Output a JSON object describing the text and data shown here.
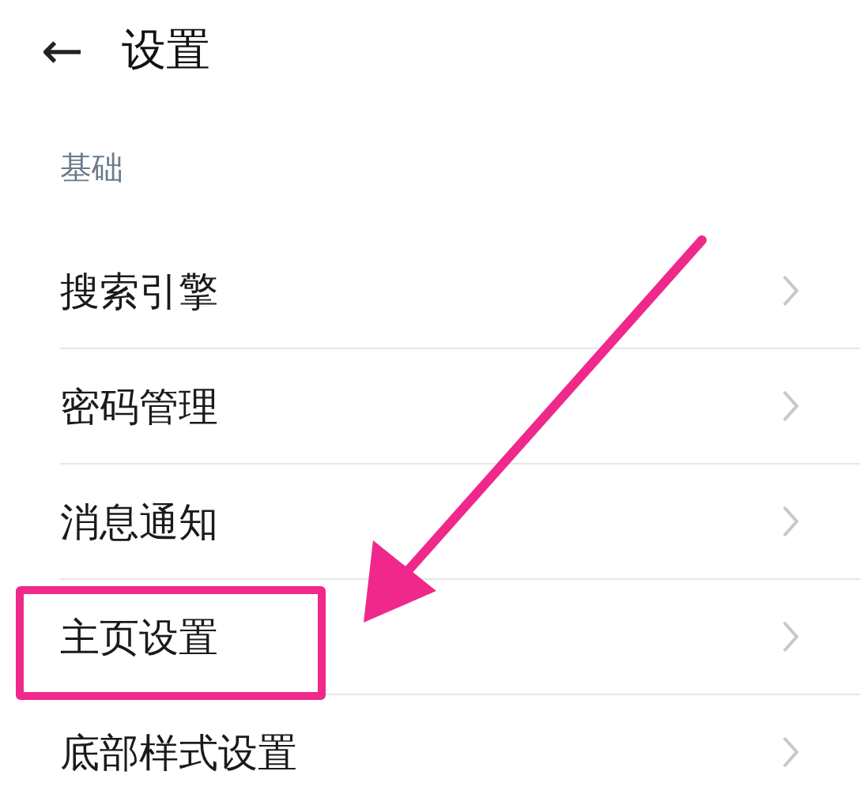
{
  "header": {
    "back": "←",
    "title": "设置"
  },
  "section": {
    "label": "基础"
  },
  "items": [
    {
      "label": "搜索引擎",
      "highlighted": false
    },
    {
      "label": "密码管理",
      "highlighted": false
    },
    {
      "label": "消息通知",
      "highlighted": false
    },
    {
      "label": "主页设置",
      "highlighted": true
    },
    {
      "label": "底部样式设置",
      "highlighted": false
    }
  ]
}
